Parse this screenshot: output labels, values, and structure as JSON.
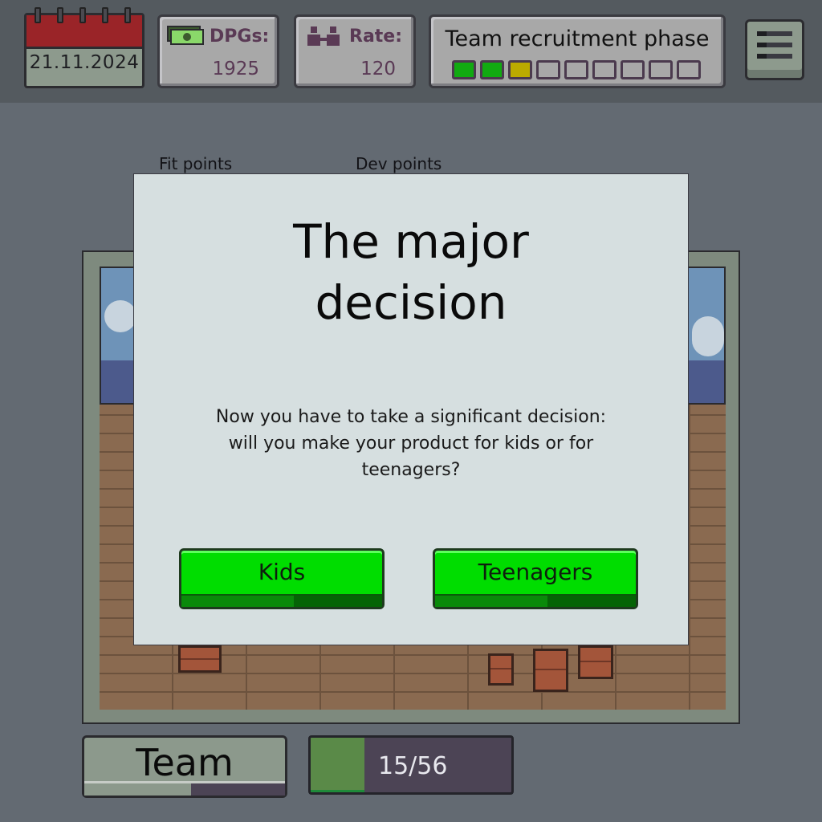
{
  "header": {
    "date": "21.11.2024",
    "dpgs": {
      "label": "DPGs:",
      "value": "1925",
      "icon": "cash-icon"
    },
    "rate": {
      "label": "Rate:",
      "value": "120",
      "icon": "people-icon"
    },
    "phase": {
      "title": "Team recruitment phase",
      "steps_total": 9,
      "steps": [
        "done",
        "done",
        "current",
        "todo",
        "todo",
        "todo",
        "todo",
        "todo",
        "todo"
      ],
      "colors": {
        "done": "#11aa11",
        "current": "#bbaa00",
        "todo": "transparent"
      }
    },
    "menu_icon": "hamburger-menu-icon"
  },
  "background_labels": {
    "fit_points": "Fit points",
    "dev_points": "Dev points"
  },
  "dialog": {
    "title_line1": "The major",
    "title_line2": "decision",
    "body_line1": "Now you have to take a significant decision:",
    "body_line2": "will you make your product for kids or for",
    "body_line3": "teenagers?",
    "option_kids": "Kids",
    "option_teenagers": "Teenagers"
  },
  "footer": {
    "team_button": "Team",
    "team_progress_text": "15/56",
    "team_progress_fraction": 0.268
  },
  "colors": {
    "choice_green": "#00dd00",
    "calendar_red": "#9a2428",
    "progress_green": "#5a8a48"
  }
}
